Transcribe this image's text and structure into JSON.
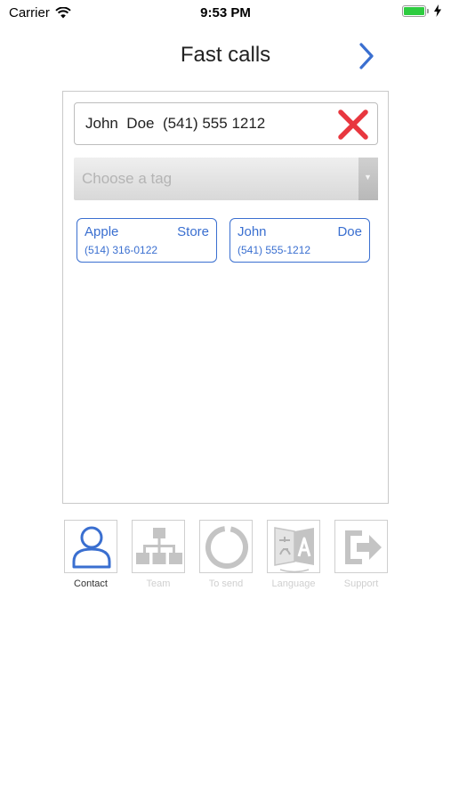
{
  "status_bar": {
    "carrier": "Carrier",
    "time": "9:53 PM",
    "battery_level": 1.0
  },
  "nav": {
    "title": "Fast calls",
    "next_icon": "chevron-right-icon"
  },
  "search": {
    "value": "John  Doe  (541) 555 1212",
    "clear_icon": "red-x-icon"
  },
  "tag_select": {
    "placeholder": "Choose a tag"
  },
  "contacts": [
    {
      "first": "Apple",
      "last": "Store",
      "phone": "(514) 316-0122"
    },
    {
      "first": "John",
      "last": "Doe",
      "phone": "(541) 555-1212"
    }
  ],
  "tabs": [
    {
      "label": "Contact",
      "icon": "person-icon",
      "active": true
    },
    {
      "label": "Team",
      "icon": "org-chart-icon",
      "active": false
    },
    {
      "label": "To send",
      "icon": "circle-progress-icon",
      "active": false
    },
    {
      "label": "Language",
      "icon": "translate-icon",
      "active": false
    },
    {
      "label": "Support",
      "icon": "logout-icon",
      "active": false
    }
  ],
  "colors": {
    "accent": "#3a6fd0",
    "inactive": "#cfcfcf",
    "clear_red": "#e8373f",
    "battery": "#2ecc40"
  }
}
